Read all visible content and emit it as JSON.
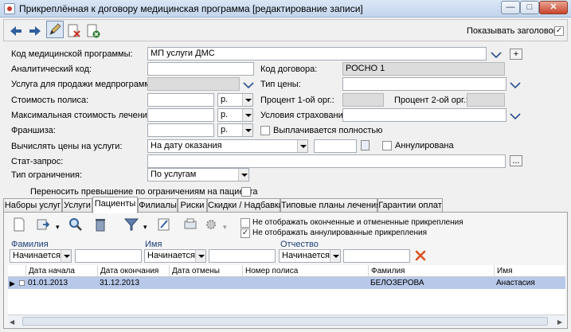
{
  "window": {
    "title": "Прикреплённая к договору медицинская программа [редактирование записи]",
    "min_glyph": "—",
    "max_glyph": "□",
    "close_glyph": "✕"
  },
  "toolbar": {
    "show_headers_label": "Показывать заголовок",
    "show_headers_checked": true,
    "check_glyph": "✓"
  },
  "form": {
    "program_code_label": "Код медицинской программы:",
    "program_code_value": "МП услуги ДМС",
    "add_glyph": "+",
    "analytic_code_label": "Аналитический код:",
    "analytic_code_value": "",
    "contract_code_label": "Код договора:",
    "contract_code_value": "РОСНО 1",
    "sale_service_label": "Услуга для продажи медпрограммы:",
    "sale_service_value": "",
    "price_type_label": "Тип цены:",
    "price_type_value": "",
    "policy_cost_label": "Стоимость полиса:",
    "policy_cost_value": "",
    "policy_cost_currency": "р.",
    "org1_percent_label": "Процент 1-ой орг.:",
    "org2_percent_label": "Процент 2-ой орг.:",
    "max_cost_label": "Максимальная стоимость лечения:",
    "max_cost_value": "",
    "max_cost_currency": "р.",
    "insurance_terms_label": "Условия страхования:",
    "insurance_terms_value": "",
    "franchise_label": "Франшиза:",
    "franchise_value": "",
    "franchise_currency": "р.",
    "paid_fully_label": "Выплачивается полностью",
    "calc_prices_label": "Вычислять цены на услуги:",
    "calc_prices_value": "На дату оказания",
    "annulled_label": "Аннулирована",
    "stat_query_label": "Стат-запрос:",
    "stat_query_value": "",
    "ellipsis": "...",
    "limit_type_label": "Тип ограничения:",
    "limit_type_value": "По услугам",
    "transfer_excess_label": "Переносить превышение по ограничениям на пациента"
  },
  "tabs": [
    {
      "label": "Наборы услуг"
    },
    {
      "label": "Услуги"
    },
    {
      "label": "Пациенты",
      "active": true
    },
    {
      "label": "Филиалы"
    },
    {
      "label": "Риски"
    },
    {
      "label": "Скидки / Надбавки"
    },
    {
      "label": "Типовые планы лечения"
    },
    {
      "label": "Гарантии оплат"
    }
  ],
  "patients": {
    "hide_finished_label": "Не отображать оконченные и отмененные прикрепления",
    "hide_finished_checked": false,
    "hide_annulled_label": "Не отображать аннулированные прикрепления",
    "hide_annulled_checked": true,
    "filters": {
      "surname_label": "Фамилия",
      "name_label": "Имя",
      "patronymic_label": "Отчество",
      "surname_mode": "Начинается",
      "name_mode": "Начинается",
      "patronymic_mode": "Начинается",
      "surname_value": "",
      "name_value": "",
      "patronymic_value": ""
    },
    "columns": [
      "Дата начала",
      "Дата окончания",
      "Дата отмены",
      "Номер полиса",
      "Фамилия",
      "Имя"
    ],
    "rows": [
      {
        "start": "01.01.2013",
        "end": "31.12.2013",
        "cancel": "",
        "policy": "",
        "surname": "БЕЛОЗЕРОВА",
        "name": "Анастасия"
      }
    ]
  },
  "colors": {
    "accent": "#2f5f9e",
    "selection": "#b7c8e9",
    "chevron": "#2b4f8f",
    "clear_icon": "#d9531e"
  },
  "icons": [
    "back-arrow-icon",
    "forward-arrow-icon",
    "edit-pen-icon",
    "delete-document-icon",
    "cancel-document-icon",
    "new-document-icon",
    "export-icon",
    "search-icon",
    "trash-icon",
    "filter-icon",
    "edit-icon",
    "print-icon",
    "settings-icon",
    "clear-filter-icon",
    "chevron-down-icon"
  ]
}
